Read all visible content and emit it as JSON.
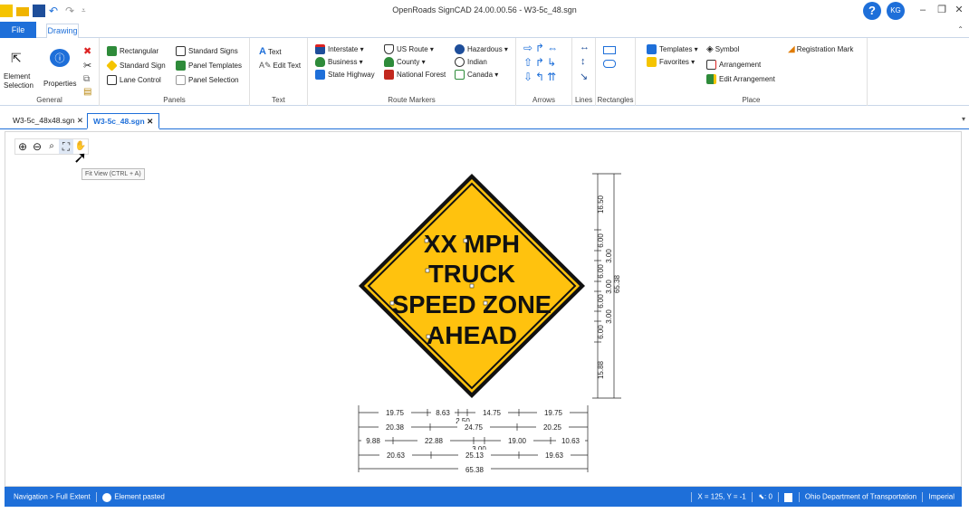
{
  "app": {
    "title": "OpenRoads SignCAD 24.00.00.56 - W3-5c_48.sgn",
    "help": "?",
    "user_initials": "KG"
  },
  "window_controls": {
    "minimize": "–",
    "restore": "❐",
    "close": "✕"
  },
  "ribbon_tabs": {
    "file": "File",
    "drawing": "Drawing"
  },
  "ribbon": {
    "general": {
      "label": "General",
      "element_selection": "Element Selection",
      "properties": "Properties"
    },
    "panels": {
      "label": "Panels",
      "rectangular": "Rectangular",
      "standard_sign": "Standard Sign",
      "lane_control": "Lane Control",
      "standard_signs": "Standard Signs",
      "panel_templates": "Panel Templates",
      "panel_selection": "Panel Selection"
    },
    "text": {
      "label": "Text",
      "text": "Text",
      "edit_text": "Edit Text"
    },
    "route_markers": {
      "label": "Route Markers",
      "interstate": "Interstate ▾",
      "business": "Business ▾",
      "state_highway": "State Highway",
      "us_route": "US Route ▾",
      "county": "County ▾",
      "national_forest": "National Forest",
      "hazardous": "Hazardous ▾",
      "indian": "Indian",
      "canada": "Canada ▾"
    },
    "arrows": {
      "label": "Arrows"
    },
    "lines": {
      "label": "Lines"
    },
    "rectangles": {
      "label": "Rectangles"
    },
    "place": {
      "label": "Place",
      "templates": "Templates ▾",
      "favorites": "Favorites ▾",
      "symbol": "Symbol",
      "arrangement": "Arrangement",
      "edit_arrangement": "Edit Arrangement",
      "registration_mark": "Registration Mark"
    }
  },
  "document_tabs": [
    {
      "label": "W3-5c_48x48.sgn",
      "active": false
    },
    {
      "label": "W3-5c_48.sgn",
      "active": true
    }
  ],
  "nav_tools": {
    "zoom_in": "⊕",
    "zoom_out": "⊖",
    "zoom_window": "🔍",
    "fit_view": "⛶",
    "pan": "✋"
  },
  "tooltip": "Fit View (CTRL + A)",
  "sign": {
    "lines": [
      "XX MPH",
      "TRUCK",
      "SPEED ZONE",
      "AHEAD"
    ],
    "fill_color": "#FFC20E",
    "border_color": "#111111"
  },
  "dimensions": {
    "vertical": [
      "16.50",
      "6.00",
      "3.00",
      "6.00",
      "3.00",
      "6.00",
      "3.00",
      "6.00",
      "15.88",
      "65.38"
    ],
    "horizontal_rows": [
      [
        "19.75",
        "8.63",
        "14.75",
        "19.75"
      ],
      [
        "2.50"
      ],
      [
        "20.38",
        "24.75",
        "20.25"
      ],
      [
        "9.88",
        "22.88",
        "19.00",
        "10.63"
      ],
      [
        "3.00"
      ],
      [
        "20.63",
        "25.13",
        "19.63"
      ],
      [
        "65.38"
      ]
    ]
  },
  "status": {
    "navigation": "Navigation > Full Extent",
    "message": "Element pasted",
    "coords": "X = 125, Y = -1",
    "selection_count": ": 0",
    "organization": "Ohio Department of Transportation",
    "units": "Imperial"
  },
  "colors": {
    "accent": "#1E6FD9",
    "sign_yellow": "#FFC20E"
  }
}
